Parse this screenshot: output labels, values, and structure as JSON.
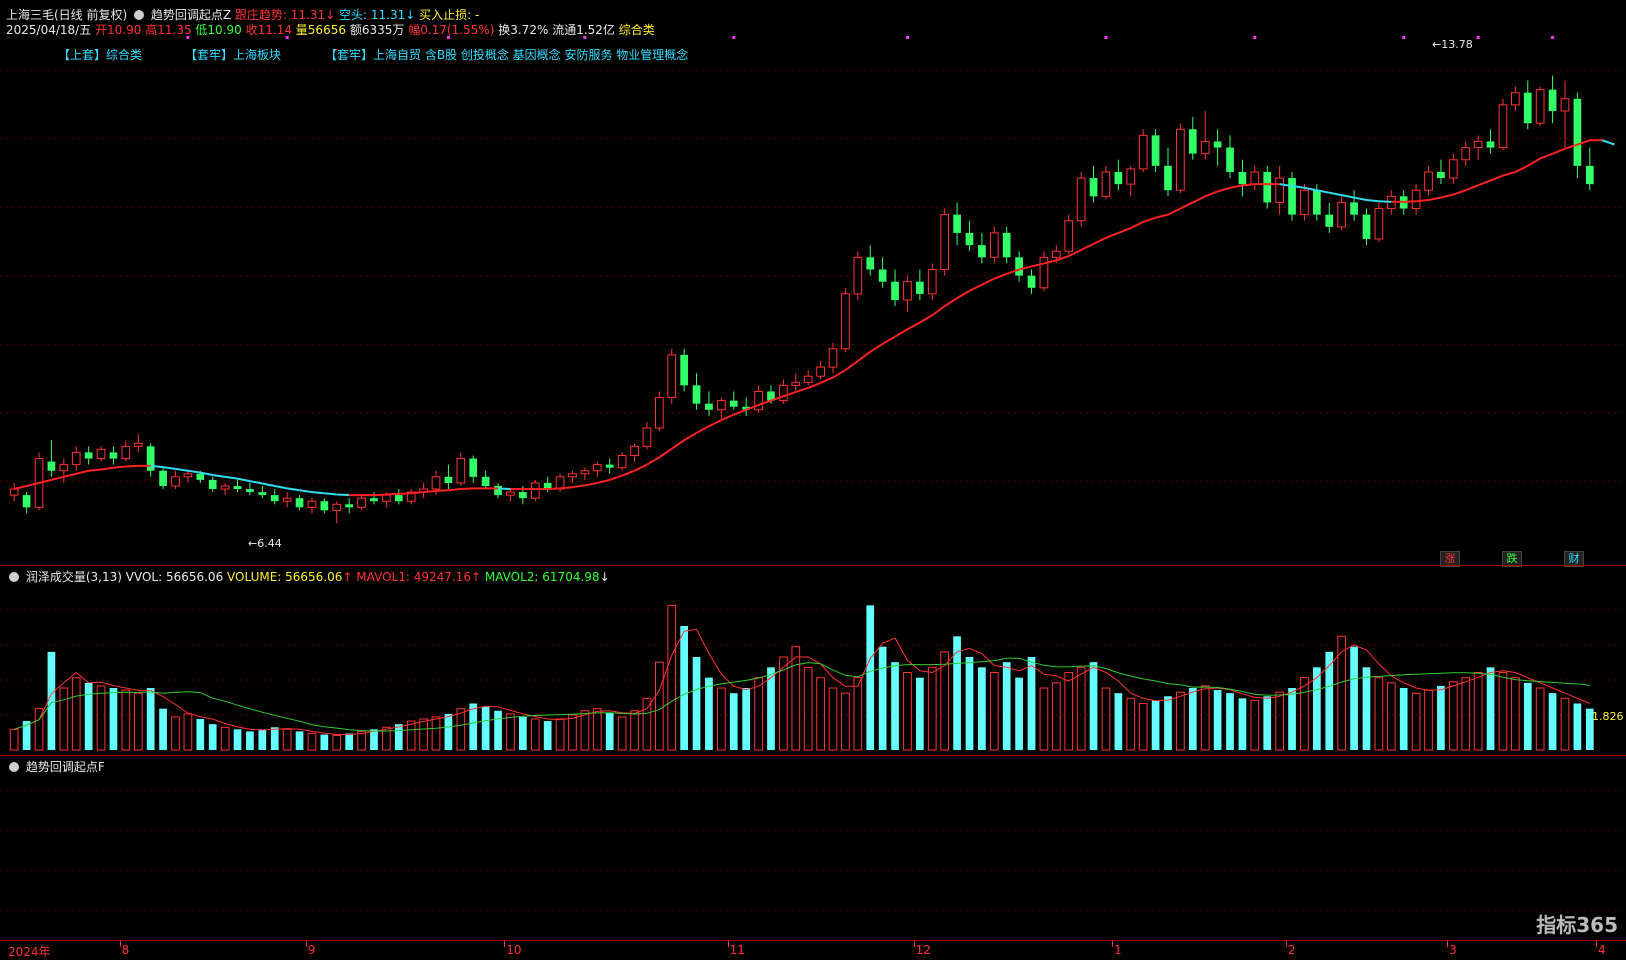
{
  "header": {
    "stock_title": "上海三毛(日线 前复权)",
    "indicator_name": "趋势回调起点Z",
    "follow_label": "跟庄趋势: 11.31",
    "short_label": "空头: 11.31",
    "stop_label": "买入止损: -",
    "date": "2025/04/18/五",
    "open_label": "开10.90",
    "high_label": "高11.35",
    "low_label": "低10.90",
    "close_label": "收11.14",
    "volume_label": "量56656",
    "amount_label": "额6335万",
    "change_label": "幅0.17(1.55%)",
    "turnover_label": "换3.72%",
    "float_label": "流通1.52亿",
    "sector_label": "综合类"
  },
  "tags": {
    "tag1": "【上套】综合类",
    "tag2": "【套牢】上海板块",
    "tag3": "【套牢】上海自贸 含B股 创投概念 基因概念 安防服务 物业管理概念"
  },
  "annotations": {
    "high": "13.78",
    "low": "6.44"
  },
  "badges": {
    "rise": "涨",
    "fall": "跌",
    "finance": "财"
  },
  "volume_panel": {
    "name": "润泽成交量(3,13)",
    "vvol": "VVOL: 56656.06",
    "volume": "VOLUME: 56656.06",
    "mavol1": "MAVOL1: 49247.16",
    "mavol2": "MAVOL2: 61704.98",
    "right_value": "1.826"
  },
  "third_panel": {
    "name": "趋势回调起点F"
  },
  "axis": {
    "year": "2024年",
    "months": [
      "8",
      "9",
      "10",
      "11",
      "12",
      "1",
      "2",
      "3",
      "4"
    ]
  },
  "watermark": "指标365",
  "colors": {
    "up": "#ff3333",
    "down": "#33ff66",
    "ma_up": "#ff2222",
    "ma_down": "#33ddee",
    "vol_up": "#ff3333",
    "vol_down": "#66ffff",
    "mavol1": "#ff3333",
    "mavol2": "#33cc33"
  },
  "chart_data": {
    "type": "candlestick",
    "candles_ohlc": [
      [
        6.9,
        7.1,
        6.8,
        7.0
      ],
      [
        6.9,
        6.95,
        6.6,
        6.7
      ],
      [
        6.7,
        7.6,
        6.65,
        7.5
      ],
      [
        7.45,
        7.8,
        7.2,
        7.3
      ],
      [
        7.3,
        7.5,
        7.1,
        7.4
      ],
      [
        7.4,
        7.7,
        7.3,
        7.6
      ],
      [
        7.6,
        7.7,
        7.4,
        7.5
      ],
      [
        7.5,
        7.7,
        7.45,
        7.65
      ],
      [
        7.6,
        7.7,
        7.4,
        7.5
      ],
      [
        7.5,
        7.8,
        7.45,
        7.7
      ],
      [
        7.7,
        7.9,
        7.6,
        7.75
      ],
      [
        7.7,
        7.75,
        7.2,
        7.3
      ],
      [
        7.3,
        7.35,
        7.0,
        7.05
      ],
      [
        7.05,
        7.3,
        7.0,
        7.2
      ],
      [
        7.2,
        7.3,
        7.1,
        7.25
      ],
      [
        7.25,
        7.3,
        7.1,
        7.15
      ],
      [
        7.15,
        7.2,
        6.95,
        7.0
      ],
      [
        7.0,
        7.1,
        6.9,
        7.05
      ],
      [
        7.05,
        7.15,
        6.95,
        7.0
      ],
      [
        7.0,
        7.1,
        6.9,
        6.95
      ],
      [
        6.95,
        7.05,
        6.85,
        6.9
      ],
      [
        6.9,
        7.0,
        6.75,
        6.8
      ],
      [
        6.8,
        6.95,
        6.7,
        6.85
      ],
      [
        6.85,
        6.9,
        6.65,
        6.7
      ],
      [
        6.7,
        6.85,
        6.6,
        6.8
      ],
      [
        6.8,
        6.85,
        6.6,
        6.65
      ],
      [
        6.65,
        6.8,
        6.44,
        6.75
      ],
      [
        6.75,
        6.85,
        6.6,
        6.7
      ],
      [
        6.7,
        6.9,
        6.65,
        6.85
      ],
      [
        6.85,
        6.95,
        6.75,
        6.8
      ],
      [
        6.8,
        6.95,
        6.7,
        6.9
      ],
      [
        6.9,
        7.0,
        6.75,
        6.8
      ],
      [
        6.8,
        7.0,
        6.75,
        6.95
      ],
      [
        6.95,
        7.1,
        6.85,
        7.0
      ],
      [
        7.0,
        7.3,
        6.9,
        7.2
      ],
      [
        7.2,
        7.4,
        7.0,
        7.1
      ],
      [
        7.1,
        7.6,
        7.05,
        7.5
      ],
      [
        7.5,
        7.55,
        7.1,
        7.2
      ],
      [
        7.2,
        7.3,
        7.0,
        7.05
      ],
      [
        7.05,
        7.1,
        6.85,
        6.9
      ],
      [
        6.9,
        7.0,
        6.8,
        6.95
      ],
      [
        6.95,
        7.05,
        6.75,
        6.85
      ],
      [
        6.85,
        7.15,
        6.8,
        7.1
      ],
      [
        7.1,
        7.2,
        6.95,
        7.0
      ],
      [
        7.0,
        7.25,
        6.95,
        7.2
      ],
      [
        7.2,
        7.3,
        7.1,
        7.25
      ],
      [
        7.25,
        7.35,
        7.15,
        7.3
      ],
      [
        7.3,
        7.45,
        7.2,
        7.4
      ],
      [
        7.4,
        7.5,
        7.25,
        7.35
      ],
      [
        7.35,
        7.6,
        7.3,
        7.55
      ],
      [
        7.55,
        7.75,
        7.45,
        7.7
      ],
      [
        7.7,
        8.1,
        7.65,
        8.0
      ],
      [
        8.0,
        8.6,
        7.95,
        8.5
      ],
      [
        8.5,
        9.3,
        8.4,
        9.2
      ],
      [
        9.2,
        9.3,
        8.6,
        8.7
      ],
      [
        8.7,
        8.9,
        8.3,
        8.4
      ],
      [
        8.4,
        8.6,
        8.2,
        8.3
      ],
      [
        8.3,
        8.5,
        8.15,
        8.45
      ],
      [
        8.45,
        8.6,
        8.3,
        8.35
      ],
      [
        8.35,
        8.5,
        8.2,
        8.3
      ],
      [
        8.3,
        8.7,
        8.25,
        8.6
      ],
      [
        8.6,
        8.7,
        8.4,
        8.45
      ],
      [
        8.45,
        8.8,
        8.4,
        8.7
      ],
      [
        8.7,
        8.9,
        8.6,
        8.75
      ],
      [
        8.75,
        8.95,
        8.7,
        8.85
      ],
      [
        8.85,
        9.1,
        8.8,
        9.0
      ],
      [
        9.0,
        9.4,
        8.9,
        9.3
      ],
      [
        9.3,
        10.3,
        9.25,
        10.2
      ],
      [
        10.2,
        10.9,
        10.1,
        10.8
      ],
      [
        10.8,
        11.0,
        10.5,
        10.6
      ],
      [
        10.6,
        10.8,
        10.3,
        10.4
      ],
      [
        10.4,
        10.6,
        10.0,
        10.1
      ],
      [
        10.1,
        10.5,
        9.9,
        10.4
      ],
      [
        10.4,
        10.6,
        10.1,
        10.2
      ],
      [
        10.2,
        10.7,
        10.1,
        10.6
      ],
      [
        10.6,
        11.6,
        10.5,
        11.5
      ],
      [
        11.5,
        11.7,
        11.0,
        11.2
      ],
      [
        11.2,
        11.4,
        10.9,
        11.0
      ],
      [
        11.0,
        11.2,
        10.7,
        10.8
      ],
      [
        10.8,
        11.3,
        10.7,
        11.2
      ],
      [
        11.2,
        11.3,
        10.7,
        10.8
      ],
      [
        10.8,
        10.9,
        10.4,
        10.5
      ],
      [
        10.5,
        10.6,
        10.2,
        10.3
      ],
      [
        10.3,
        10.9,
        10.25,
        10.8
      ],
      [
        10.8,
        11.0,
        10.7,
        10.9
      ],
      [
        10.9,
        11.5,
        10.85,
        11.4
      ],
      [
        11.4,
        12.2,
        11.3,
        12.1
      ],
      [
        12.1,
        12.3,
        11.7,
        11.8
      ],
      [
        11.8,
        12.3,
        11.75,
        12.2
      ],
      [
        12.2,
        12.4,
        11.9,
        12.0
      ],
      [
        12.0,
        12.3,
        11.8,
        12.25
      ],
      [
        12.25,
        12.9,
        12.2,
        12.8
      ],
      [
        12.8,
        12.9,
        12.2,
        12.3
      ],
      [
        12.3,
        12.6,
        11.8,
        11.9
      ],
      [
        11.9,
        13.0,
        11.85,
        12.9
      ],
      [
        12.9,
        13.1,
        12.4,
        12.5
      ],
      [
        12.5,
        13.2,
        12.4,
        12.7
      ],
      [
        12.7,
        12.9,
        12.3,
        12.6
      ],
      [
        12.6,
        12.8,
        12.1,
        12.2
      ],
      [
        12.2,
        12.4,
        11.8,
        12.0
      ],
      [
        12.0,
        12.3,
        11.9,
        12.2
      ],
      [
        12.2,
        12.3,
        11.6,
        11.7
      ],
      [
        11.7,
        12.3,
        11.5,
        12.1
      ],
      [
        12.1,
        12.2,
        11.4,
        11.5
      ],
      [
        11.5,
        12.0,
        11.4,
        11.9
      ],
      [
        11.9,
        12.0,
        11.4,
        11.5
      ],
      [
        11.5,
        11.7,
        11.2,
        11.3
      ],
      [
        11.3,
        11.8,
        11.25,
        11.7
      ],
      [
        11.7,
        11.9,
        11.4,
        11.5
      ],
      [
        11.5,
        11.6,
        11.0,
        11.1
      ],
      [
        11.1,
        11.7,
        11.05,
        11.6
      ],
      [
        11.6,
        11.9,
        11.5,
        11.8
      ],
      [
        11.8,
        11.9,
        11.5,
        11.6
      ],
      [
        11.6,
        12.0,
        11.5,
        11.9
      ],
      [
        11.9,
        12.3,
        11.8,
        12.2
      ],
      [
        12.2,
        12.4,
        12.0,
        12.1
      ],
      [
        12.1,
        12.5,
        12.0,
        12.4
      ],
      [
        12.4,
        12.7,
        12.3,
        12.6
      ],
      [
        12.6,
        12.8,
        12.4,
        12.7
      ],
      [
        12.7,
        12.9,
        12.5,
        12.6
      ],
      [
        12.6,
        13.4,
        12.55,
        13.3
      ],
      [
        13.3,
        13.6,
        13.2,
        13.5
      ],
      [
        13.5,
        13.7,
        12.9,
        13.0
      ],
      [
        13.0,
        13.6,
        12.95,
        13.55
      ],
      [
        13.55,
        13.78,
        13.0,
        13.2
      ],
      [
        13.2,
        13.7,
        12.6,
        13.4
      ],
      [
        13.4,
        13.5,
        12.1,
        12.3
      ],
      [
        12.3,
        12.6,
        11.9,
        12.0
      ]
    ],
    "ma_values": [
      7.0,
      7.05,
      7.1,
      7.15,
      7.2,
      7.25,
      7.3,
      7.32,
      7.35,
      7.37,
      7.38,
      7.38,
      7.36,
      7.33,
      7.3,
      7.27,
      7.23,
      7.2,
      7.17,
      7.13,
      7.09,
      7.05,
      7.01,
      6.98,
      6.95,
      6.93,
      6.91,
      6.9,
      6.9,
      6.9,
      6.91,
      6.92,
      6.93,
      6.95,
      6.97,
      6.98,
      7.0,
      7.01,
      7.01,
      7.01,
      7.0,
      7.0,
      7.0,
      7.0,
      7.01,
      7.03,
      7.06,
      7.1,
      7.15,
      7.22,
      7.3,
      7.4,
      7.52,
      7.66,
      7.8,
      7.92,
      8.03,
      8.13,
      8.22,
      8.3,
      8.38,
      8.45,
      8.52,
      8.59,
      8.66,
      8.74,
      8.83,
      8.95,
      9.1,
      9.25,
      9.38,
      9.5,
      9.62,
      9.73,
      9.85,
      10.0,
      10.13,
      10.25,
      10.35,
      10.45,
      10.53,
      10.6,
      10.65,
      10.7,
      10.75,
      10.82,
      10.92,
      11.02,
      11.12,
      11.2,
      11.28,
      11.38,
      11.45,
      11.5,
      11.6,
      11.7,
      11.8,
      11.88,
      11.94,
      11.98,
      12.0,
      12.0,
      12.0,
      11.97,
      11.94,
      11.9,
      11.86,
      11.82,
      11.78,
      11.74,
      11.72,
      11.71,
      11.71,
      11.72,
      11.74,
      11.78,
      11.83,
      11.9,
      11.98,
      12.06,
      12.14,
      12.2,
      12.3,
      12.42,
      12.5,
      12.58,
      12.65,
      12.72,
      12.72,
      12.65
    ],
    "ylim": [
      6.0,
      14.2
    ],
    "high_value": 13.78,
    "low_value": 6.44
  },
  "volume_data": {
    "values": [
      20,
      28,
      40,
      95,
      60,
      70,
      65,
      62,
      60,
      58,
      55,
      60,
      40,
      32,
      35,
      30,
      25,
      22,
      20,
      18,
      20,
      22,
      20,
      18,
      16,
      15,
      14,
      16,
      18,
      20,
      22,
      25,
      28,
      30,
      32,
      35,
      40,
      45,
      42,
      38,
      35,
      32,
      30,
      28,
      30,
      34,
      38,
      40,
      36,
      32,
      38,
      50,
      85,
      140,
      120,
      90,
      70,
      60,
      55,
      60,
      70,
      80,
      90,
      100,
      80,
      70,
      60,
      55,
      70,
      140,
      100,
      85,
      75,
      70,
      80,
      95,
      110,
      90,
      80,
      75,
      85,
      70,
      90,
      60,
      65,
      75,
      80,
      85,
      60,
      55,
      50,
      45,
      48,
      52,
      56,
      60,
      62,
      58,
      55,
      50,
      48,
      52,
      56,
      60,
      70,
      80,
      95,
      110,
      100,
      80,
      70,
      65,
      60,
      55,
      58,
      62,
      66,
      70,
      75,
      80,
      75,
      70,
      65,
      60,
      55,
      50,
      45,
      40,
      38,
      35
    ],
    "ylim": [
      0,
      150
    ]
  }
}
